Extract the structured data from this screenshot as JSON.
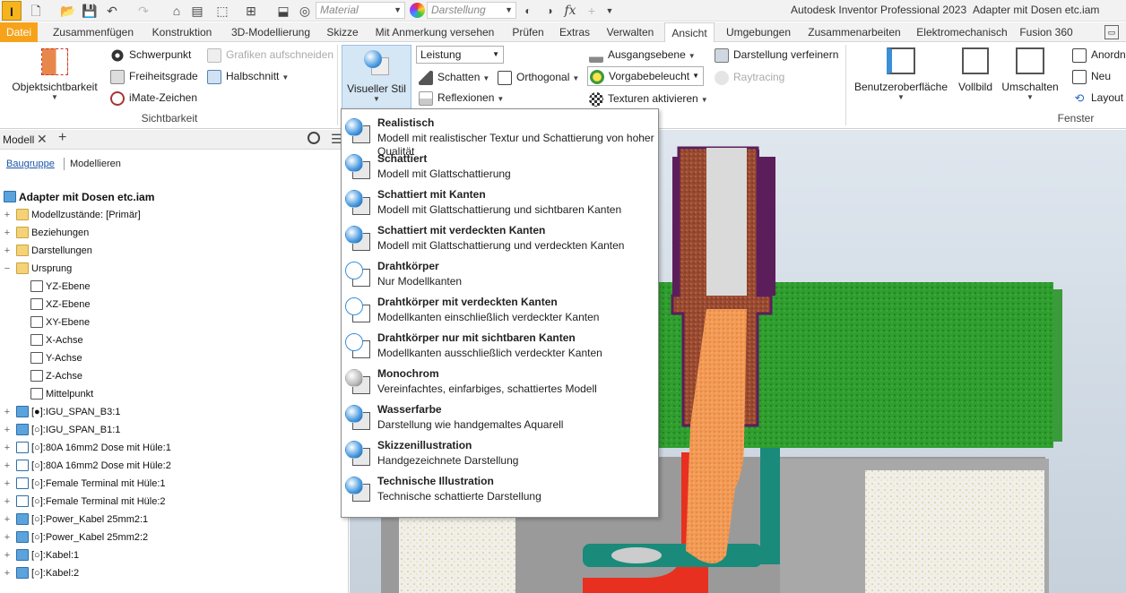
{
  "app": {
    "icon_letter": "I",
    "title": "Autodesk Inventor Professional 2023",
    "document": "Adapter mit Dosen etc.iam"
  },
  "qat": {
    "material_placeholder": "Material",
    "appearance_placeholder": "Darstellung",
    "fx_label": "fx"
  },
  "tabs": [
    {
      "label": "Datei"
    },
    {
      "label": "Zusammenfügen"
    },
    {
      "label": "Konstruktion"
    },
    {
      "label": "3D-Modellierung"
    },
    {
      "label": "Skizze"
    },
    {
      "label": "Mit Anmerkung versehen"
    },
    {
      "label": "Prüfen"
    },
    {
      "label": "Extras"
    },
    {
      "label": "Verwalten"
    },
    {
      "label": "Ansicht"
    },
    {
      "label": "Umgebungen"
    },
    {
      "label": "Zusammenarbeiten"
    },
    {
      "label": "Elektromechanisch"
    },
    {
      "label": "Fusion 360"
    }
  ],
  "ribbon": {
    "visibility": {
      "object_visibility": "Objektsichtbarkeit",
      "center_of_gravity": "Schwerpunkt",
      "dof": "Freiheitsgrade",
      "imate": "iMate-Zeichen",
      "slice_graphics": "Grafiken aufschneiden",
      "half_section": "Halbschnitt",
      "group_label": "Sichtbarkeit"
    },
    "appearance": {
      "visual_style": "Visueller Stil",
      "performance": "Leistung",
      "shadows": "Schatten",
      "reflections": "Reflexionen",
      "orthographic": "Orthogonal",
      "ground_plane": "Ausgangsebene",
      "lighting": "Vorgabebeleucht",
      "textures": "Texturen aktivieren",
      "refine": "Darstellung verfeinern",
      "raytracing": "Raytracing"
    },
    "window": {
      "ui": "Benutzeroberfläche",
      "fullscreen": "Vollbild",
      "switch": "Umschalten",
      "arrange": "Anordn",
      "new": "Neu",
      "layout": "Layout",
      "group_label": "Fenster"
    }
  },
  "browser": {
    "tab_label": "Modell",
    "plus": "+",
    "view_assembly": "Baugruppe",
    "view_modeling": "Modellieren",
    "items": [
      {
        "label": "Adapter mit Dosen etc.iam",
        "level": 0,
        "icon": "assembly-icon",
        "bold": true
      },
      {
        "label": "Modellzustände: [Primär]",
        "level": 1,
        "icon": "folder-icon"
      },
      {
        "label": "Beziehungen",
        "level": 1,
        "icon": "folder-icon"
      },
      {
        "label": "Darstellungen",
        "level": 1,
        "icon": "folder-icon"
      },
      {
        "label": "Ursprung",
        "level": 1,
        "icon": "folder-open-icon"
      },
      {
        "label": "YZ-Ebene",
        "level": 2,
        "icon": "plane-icon"
      },
      {
        "label": "XZ-Ebene",
        "level": 2,
        "icon": "plane-icon"
      },
      {
        "label": "XY-Ebene",
        "level": 2,
        "icon": "plane-icon"
      },
      {
        "label": "X-Achse",
        "level": 2,
        "icon": "axis-icon"
      },
      {
        "label": "Y-Achse",
        "level": 2,
        "icon": "axis-icon"
      },
      {
        "label": "Z-Achse",
        "level": 2,
        "icon": "axis-icon"
      },
      {
        "label": "Mittelpunkt",
        "level": 2,
        "icon": "point-icon"
      },
      {
        "label": "[●]:IGU_SPAN_B3:1",
        "level": 1,
        "icon": "part-icon"
      },
      {
        "label": "[○]:IGU_SPAN_B1:1",
        "level": 1,
        "icon": "part-icon"
      },
      {
        "label": "[○]:80A  16mm2 Dose mit Hüle:1",
        "level": 1,
        "icon": "subassembly-icon"
      },
      {
        "label": "[○]:80A  16mm2 Dose mit Hüle:2",
        "level": 1,
        "icon": "subassembly-icon"
      },
      {
        "label": "[○]:Female Terminal mit Hüle:1",
        "level": 1,
        "icon": "subassembly-icon"
      },
      {
        "label": "[○]:Female Terminal mit Hüle:2",
        "level": 1,
        "icon": "subassembly-icon"
      },
      {
        "label": "[○]:Power_Kabel 25mm2:1",
        "level": 1,
        "icon": "part-icon"
      },
      {
        "label": "[○]:Power_Kabel 25mm2:2",
        "level": 1,
        "icon": "part-icon"
      },
      {
        "label": "[○]:Kabel:1",
        "level": 1,
        "icon": "part-icon"
      },
      {
        "label": "[○]:Kabel:2",
        "level": 1,
        "icon": "part-icon"
      }
    ]
  },
  "visual_styles": [
    {
      "title": "Realistisch",
      "desc": "Modell mit realistischer Textur und Schattierung von hoher Qualität",
      "icon": "realistic-style-icon"
    },
    {
      "title": "Schattiert",
      "desc": "Modell mit Glattschattierung",
      "icon": "shaded-style-icon"
    },
    {
      "title": "Schattiert mit Kanten",
      "desc": "Modell mit Glattschattierung und sichtbaren Kanten",
      "icon": "shaded-edges-style-icon"
    },
    {
      "title": "Schattiert mit verdeckten Kanten",
      "desc": "Modell mit Glattschattierung und verdeckten Kanten",
      "icon": "shaded-hidden-edges-style-icon"
    },
    {
      "title": "Drahtkörper",
      "desc": "Nur Modellkanten",
      "icon": "wireframe-style-icon"
    },
    {
      "title": "Drahtkörper mit verdeckten Kanten",
      "desc": "Modellkanten einschließlich verdeckter Kanten",
      "icon": "wireframe-hidden-style-icon"
    },
    {
      "title": "Drahtkörper nur mit sichtbaren Kanten",
      "desc": "Modellkanten ausschließlich verdeckter Kanten",
      "icon": "wireframe-visible-style-icon"
    },
    {
      "title": "Monochrom",
      "desc": "Vereinfachtes, einfarbiges, schattiertes Modell",
      "icon": "monochrome-style-icon"
    },
    {
      "title": "Wasserfarbe",
      "desc": "Darstellung wie handgemaltes Aquarell",
      "icon": "watercolor-style-icon"
    },
    {
      "title": "Skizzenillustration",
      "desc": "Handgezeichnete Darstellung",
      "icon": "sketch-style-icon"
    },
    {
      "title": "Technische Illustration",
      "desc": "Technische schattierte Darstellung",
      "icon": "technical-style-icon"
    }
  ],
  "colors": {
    "accent": "#f6a31b",
    "selection_blue": "#d5e6f5",
    "model_green": "#2f9e2f",
    "model_copper": "#a0522d",
    "model_purple": "#5b1e5b"
  }
}
